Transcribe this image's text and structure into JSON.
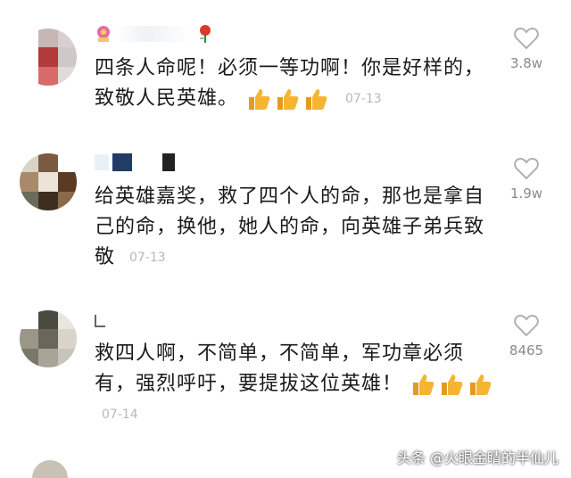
{
  "comments": [
    {
      "text": "四条人命呢！必须一等功啊！你是好样的，致敬人民英雄。",
      "date": "07-13",
      "likes": "3.8w",
      "badge_icon": "rose-icon"
    },
    {
      "text": "给英雄嘉奖，救了四个人的命，那也是拿自己的命，换他，她人的命，向英雄子弟兵致敬",
      "date": "07-13",
      "likes": "1.9w"
    },
    {
      "text": "救四人啊，不简单，不简单，军功章必须有，强烈呼吁，要提拔这位英雄！",
      "date": "07-14",
      "likes": "8465"
    }
  ],
  "watermark": "头条 @火眼金睛的半仙儿",
  "colors": {
    "thumb": "#f5b531",
    "like_icon": "#b0b0b0",
    "date": "#b8b8b8"
  }
}
